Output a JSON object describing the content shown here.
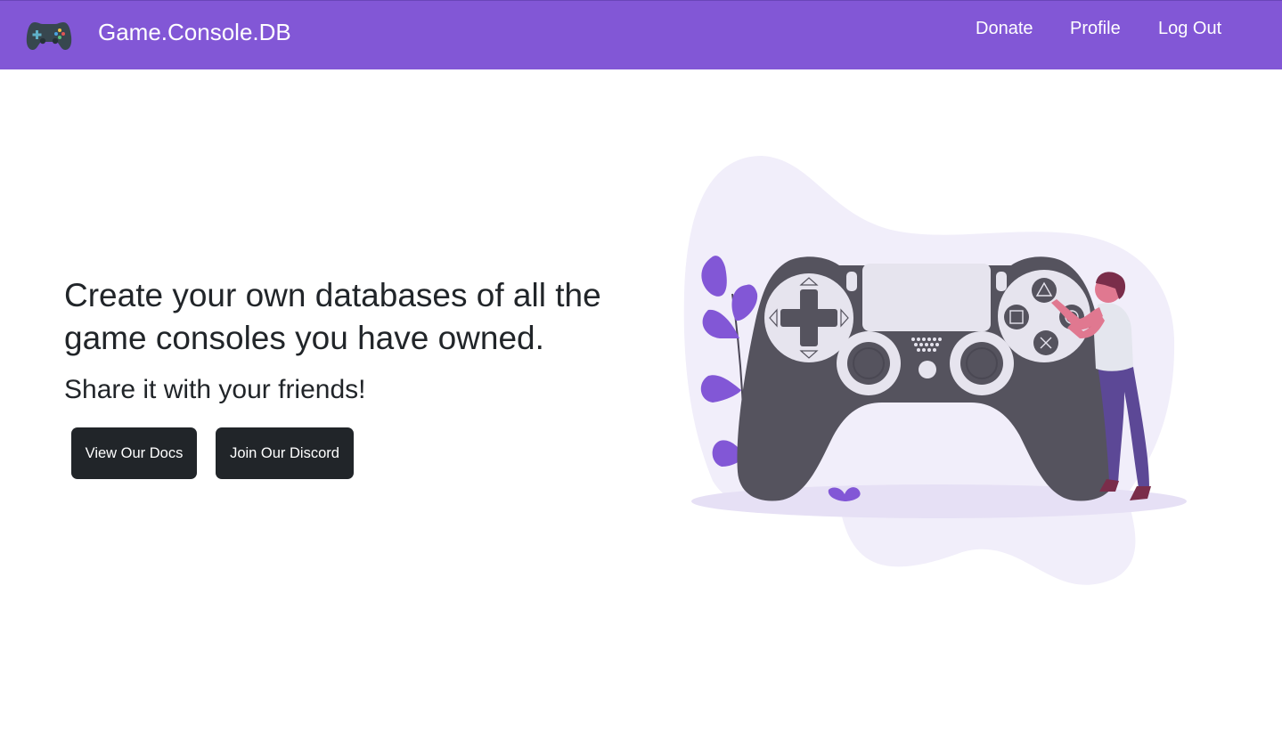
{
  "navbar": {
    "brand_icon": "gamepad-icon",
    "brand_title": "Game.Console.DB",
    "links": {
      "donate": "Donate",
      "profile": "Profile",
      "logout": "Log Out"
    },
    "background_color": "#8257d6"
  },
  "hero": {
    "headline": "Create your own databases of all the game consoles you have owned.",
    "subheadline": "Share it with your friends!",
    "buttons": {
      "docs": "View Our Docs",
      "discord": "Join Our Discord"
    },
    "illustration": "person-with-giant-gamepad-illustration"
  },
  "colors": {
    "accent": "#8257d6",
    "button_bg": "#212529",
    "text": "#212529",
    "controller": "#55535e",
    "blob": "#f1eefa"
  }
}
